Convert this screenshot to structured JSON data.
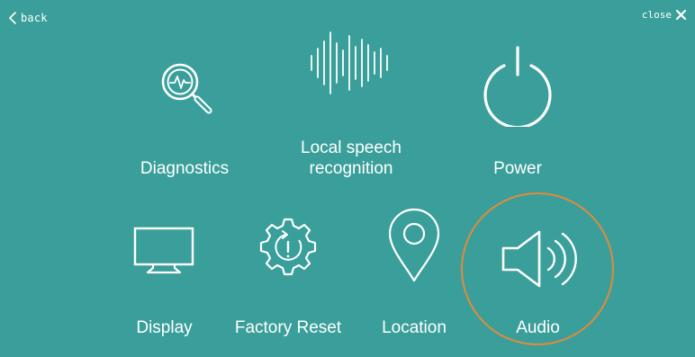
{
  "nav": {
    "back_label": "back",
    "close_label": "close"
  },
  "tiles": [
    {
      "id": "diagnostics",
      "label": "Diagnostics",
      "icon": "magnifier-pulse-icon"
    },
    {
      "id": "local-speech-recognition",
      "label_line1": "Local speech",
      "label_line2": "recognition",
      "icon": "sound-wave-icon"
    },
    {
      "id": "power",
      "label": "Power",
      "icon": "power-icon"
    },
    {
      "id": "display",
      "label": "Display",
      "icon": "monitor-icon"
    },
    {
      "id": "factory-reset",
      "label": "Factory Reset",
      "icon": "gear-reset-icon"
    },
    {
      "id": "location",
      "label": "Location",
      "icon": "location-pin-icon"
    },
    {
      "id": "audio",
      "label": "Audio",
      "icon": "speaker-icon",
      "highlighted": true
    }
  ],
  "colors": {
    "background": "#3a9f9a",
    "foreground": "#ffffff",
    "highlight": "#e08a3e"
  }
}
